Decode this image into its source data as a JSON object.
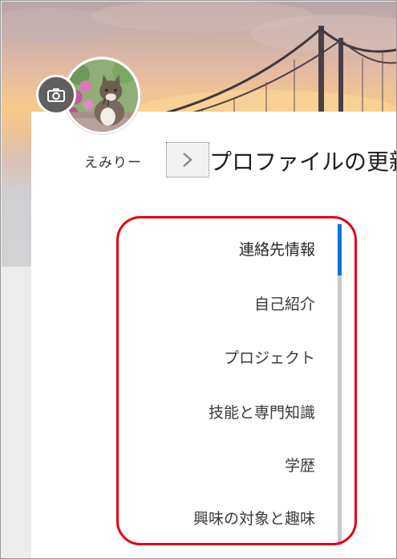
{
  "profile": {
    "name": "えみりー",
    "page_title": "プロファイルの更新"
  },
  "sections": [
    {
      "label": "連絡先情報",
      "active": true
    },
    {
      "label": "自己紹介",
      "active": false
    },
    {
      "label": "プロジェクト",
      "active": false
    },
    {
      "label": "技能と専門知識",
      "active": false
    },
    {
      "label": "学歴",
      "active": false
    },
    {
      "label": "興味の対象と趣味",
      "active": false
    }
  ],
  "icons": {
    "camera": "camera-icon",
    "breadcrumb_arrow": "chevron-right-icon"
  },
  "colors": {
    "accent": "#0a74d8",
    "annotation": "#e50012"
  }
}
